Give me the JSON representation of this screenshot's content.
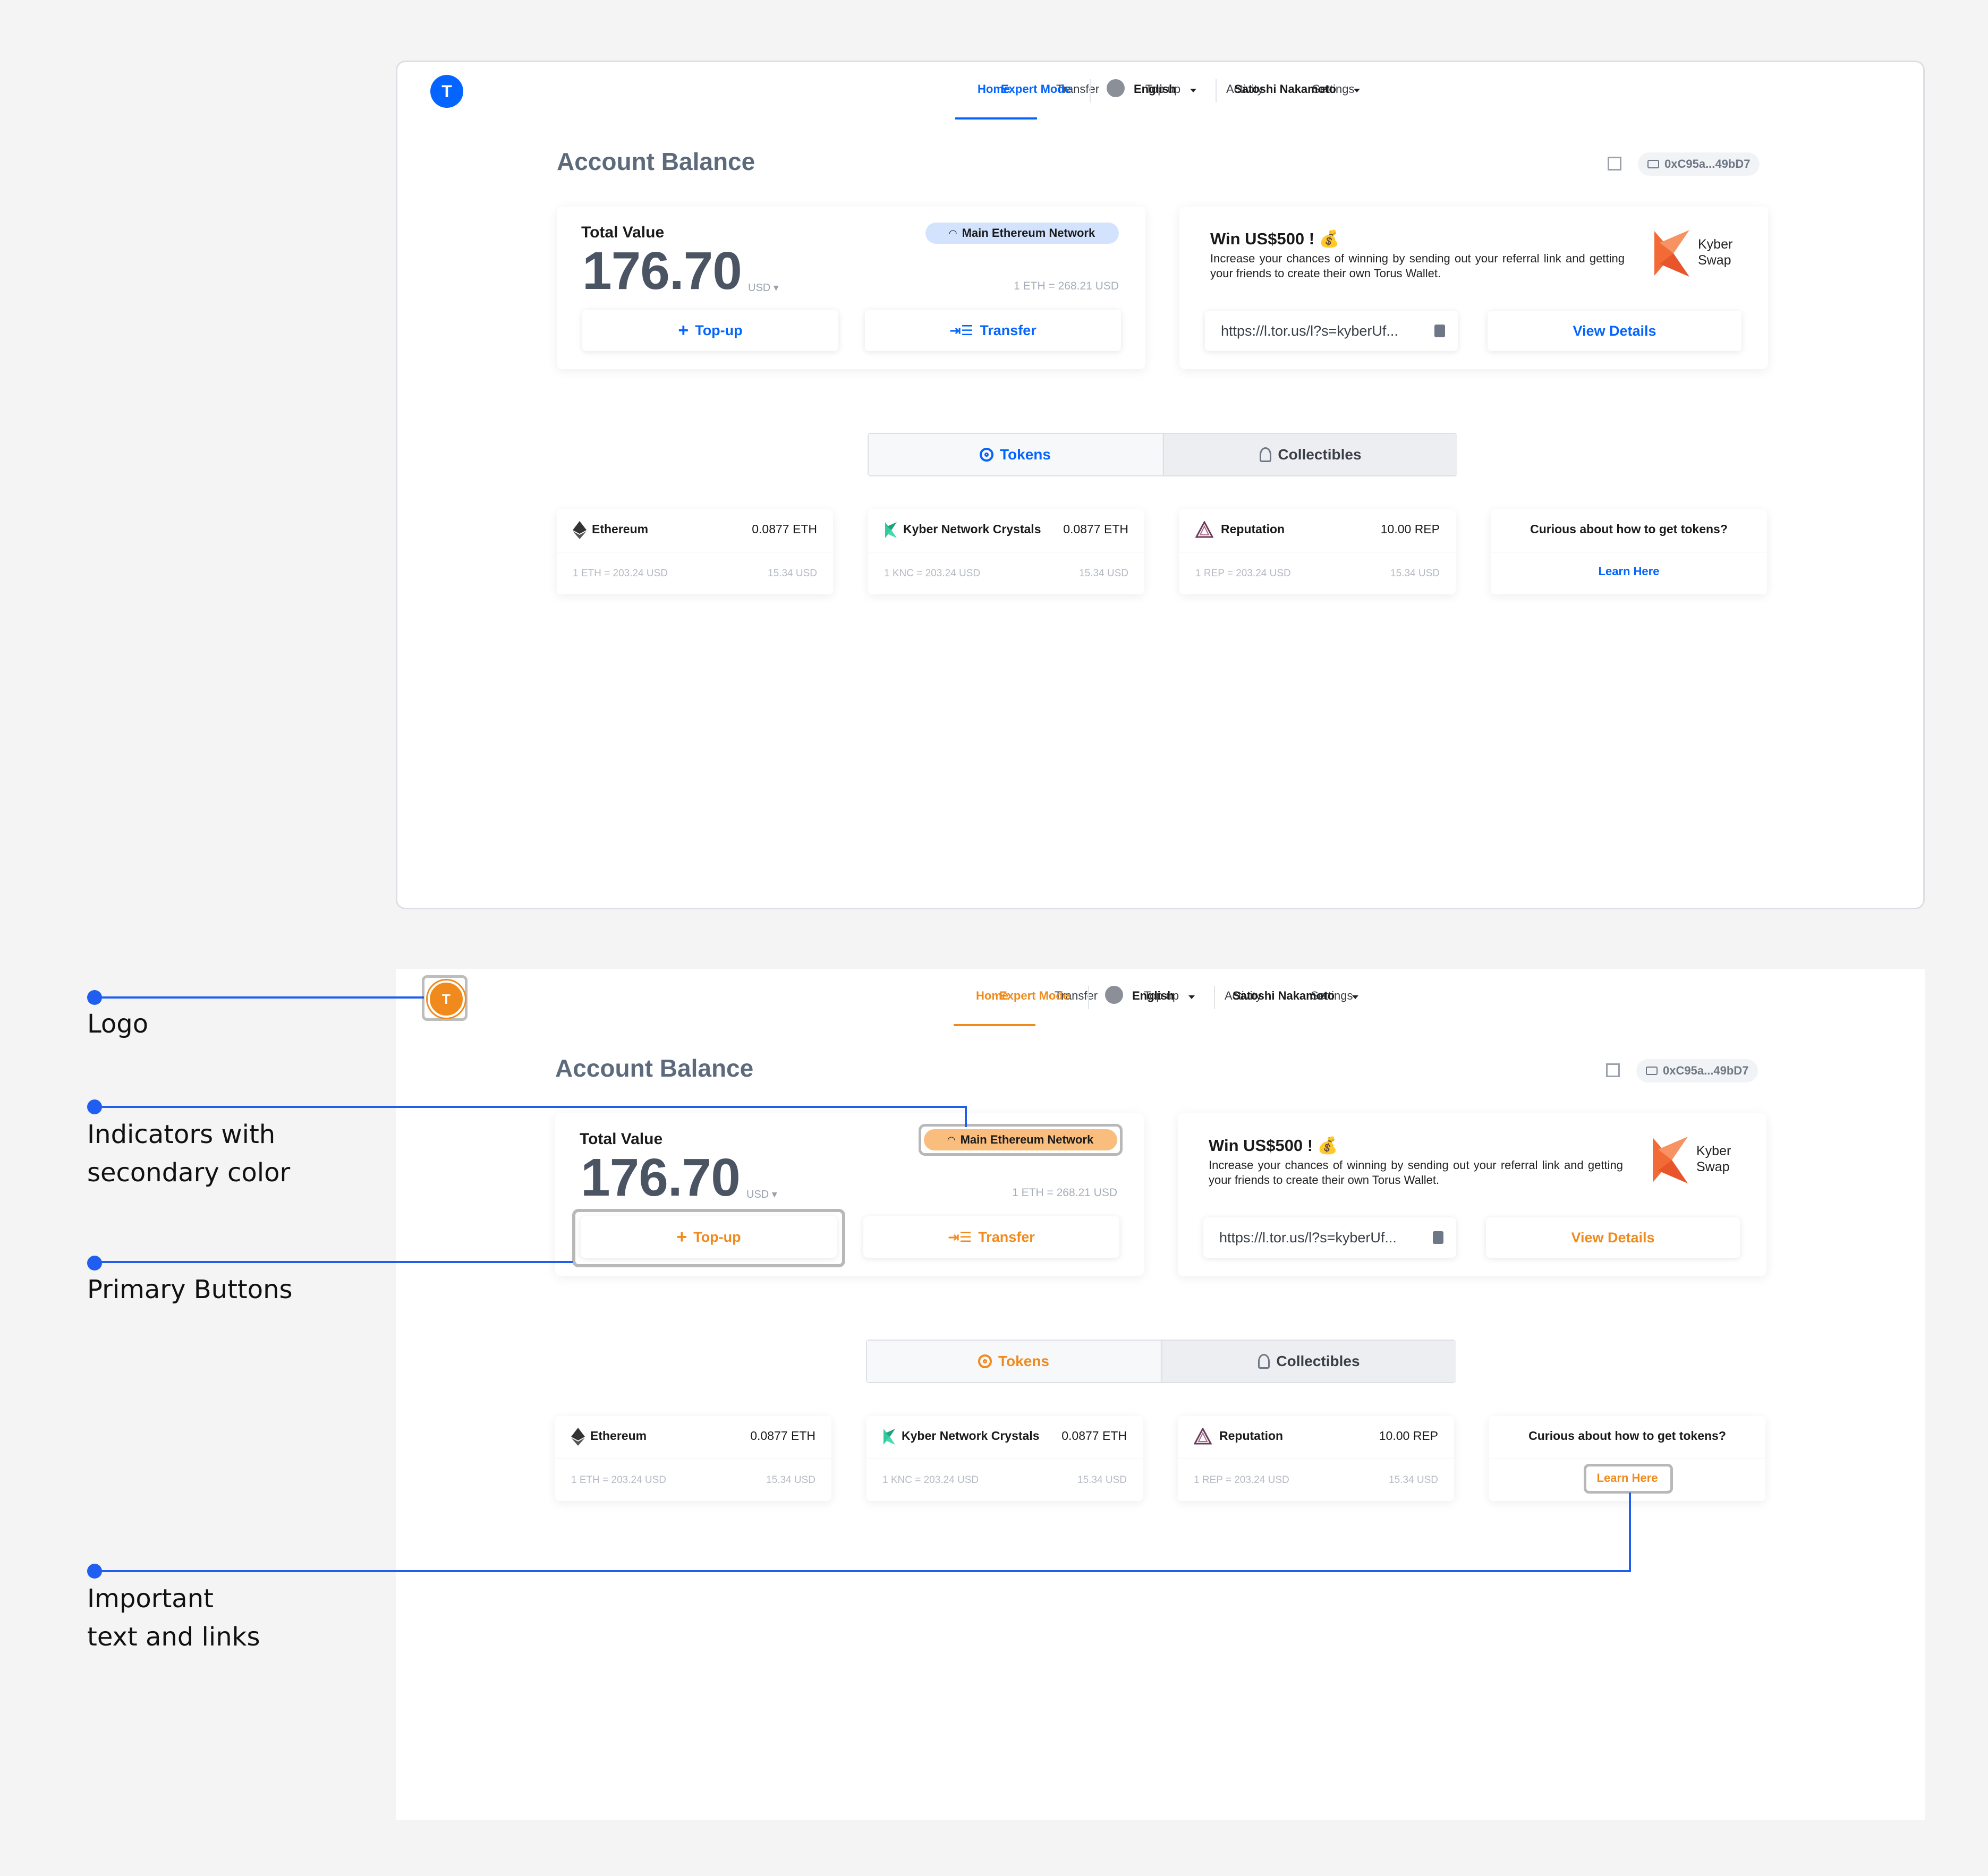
{
  "app": {
    "logo_text": "T",
    "nav": [
      "Home",
      "Transfer",
      "Top up",
      "Activity",
      "Settings"
    ],
    "expert_mode": "Expert Mode",
    "language": "English",
    "user": "Satoshi Nakamoto"
  },
  "account": {
    "title": "Account Balance",
    "address": "0xC95a...49bD7",
    "total_label": "Total Value",
    "total_value": "176.70",
    "currency": "USD",
    "network": "Main Ethereum Network",
    "eth_rate": "1 ETH = 268.21 USD",
    "topup_label": "Top-up",
    "transfer_label": "Transfer"
  },
  "promo": {
    "title": "Win US$500 ! 💰",
    "text": "Increase your chances of winning by sending out your referral link and getting your friends to create their own Torus Wallet.",
    "brand_line1": "Kyber",
    "brand_line2": "Swap",
    "ref_link": "https://l.tor.us/l?s=kyberUf...",
    "view_details": "View Details"
  },
  "tabs": {
    "tokens": "Tokens",
    "collectibles": "Collectibles"
  },
  "tokens": [
    {
      "name": "Ethereum",
      "amount": "0.0877 ETH",
      "rate": "1 ETH = 203.24 USD",
      "usd": "15.34 USD"
    },
    {
      "name": "Kyber Network Crystals",
      "amount": "0.0877 ETH",
      "rate": "1 KNC = 203.24 USD",
      "usd": "15.34 USD"
    },
    {
      "name": "Reputation",
      "amount": "10.00 REP",
      "rate": "1 REP = 203.24 USD",
      "usd": "15.34 USD"
    }
  ],
  "help": {
    "question": "Curious about how to get tokens?",
    "link": "Learn Here"
  },
  "annotations": {
    "logo": "Logo",
    "indicators_1": "Indicators with",
    "indicators_2": "secondary color",
    "buttons": "Primary Buttons",
    "important_1": "Important",
    "important_2": "text and links"
  },
  "colors": {
    "primary_blue": "#0364ff",
    "secondary_blue": "#d3e3fd",
    "primary_orange": "#f08a1c",
    "secondary_orange": "#f9be7e",
    "annotation": "#1f5ef0"
  }
}
